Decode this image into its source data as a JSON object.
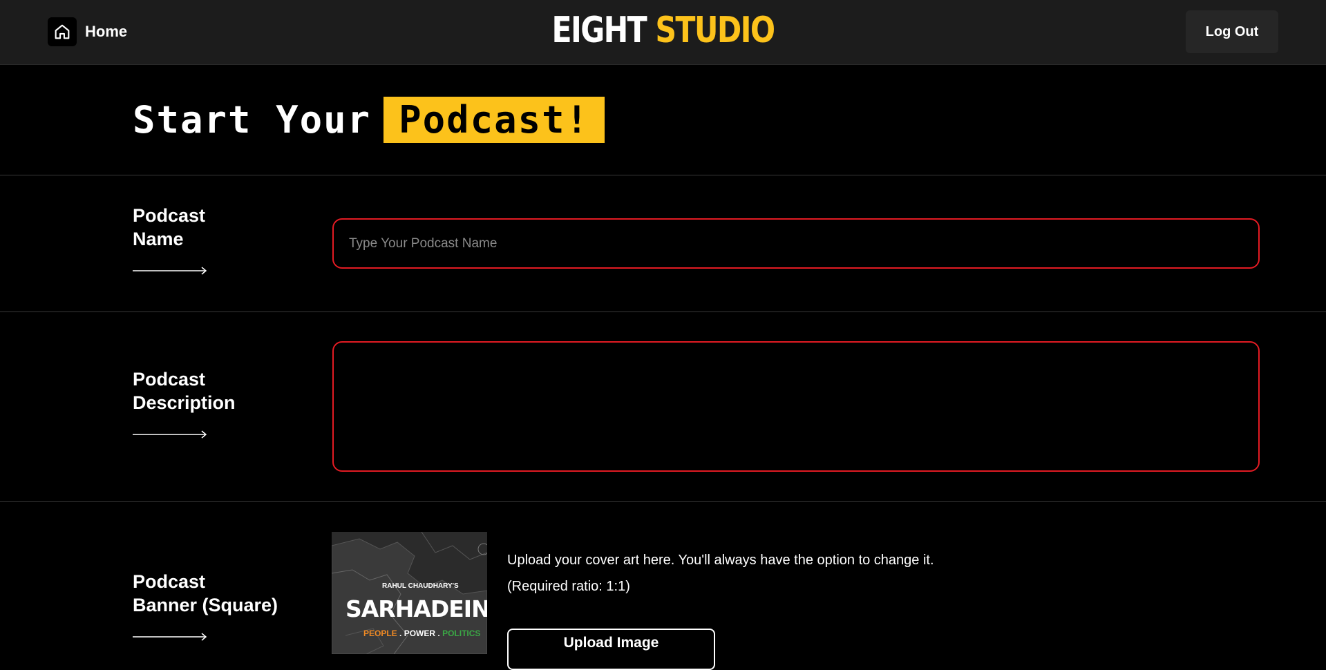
{
  "header": {
    "home_label": "Home",
    "brand_part1": "EIGHT",
    "brand_part2": "STUDIO",
    "logout_label": "Log Out"
  },
  "title": {
    "prefix": "Start Your",
    "highlight": "Podcast!"
  },
  "form": {
    "name": {
      "label_line1": "Podcast",
      "label_line2": "Name",
      "placeholder": "Type Your Podcast Name",
      "value": ""
    },
    "description": {
      "label_line1": "Podcast",
      "label_line2": "Description",
      "placeholder": "",
      "value": ""
    },
    "banner": {
      "label_line1": "Podcast",
      "label_line2": "Banner (Square)",
      "upload_hint": "Upload your cover art here. You'll always have the option to change it.",
      "ratio_hint": "(Required ratio: 1:1)",
      "upload_button": "Upload Image",
      "cover": {
        "subtitle": "RAHUL CHAUDHARY'S",
        "title": "SARHADEIN",
        "tag_people": "PEOPLE",
        "tag_power": "POWER",
        "tag_politics": "POLITICS"
      }
    }
  },
  "colors": {
    "accent": "#fcc21b",
    "error_border": "#e31b23",
    "header_bg": "#1c1c1c"
  }
}
